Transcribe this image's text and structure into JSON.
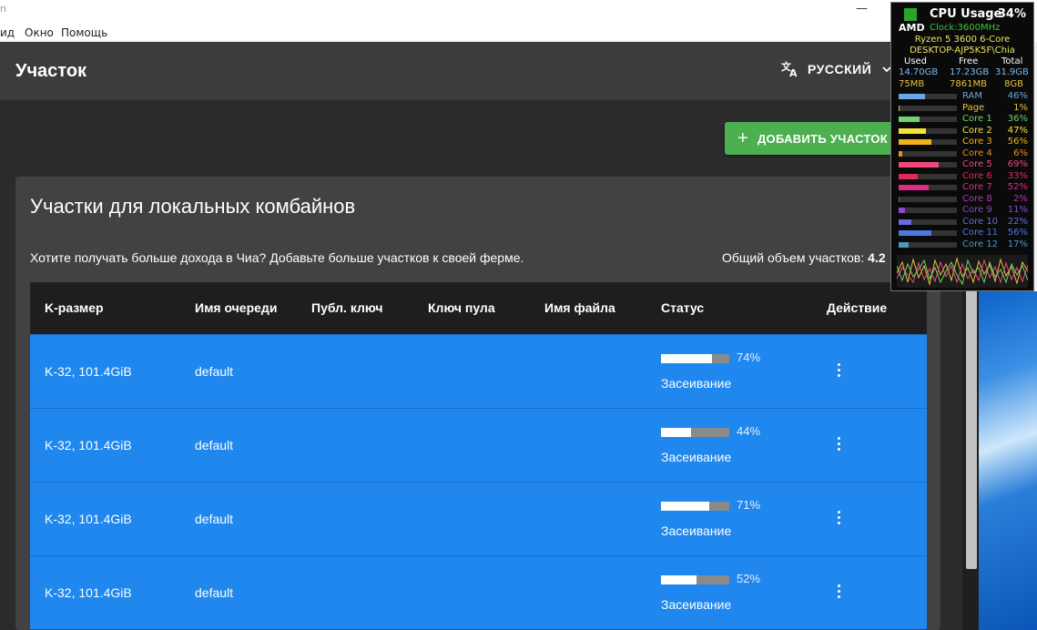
{
  "window": {
    "title_fragment": "n",
    "menu": [
      "ид",
      "Окно",
      "Помощь"
    ]
  },
  "appbar": {
    "title": "Участок",
    "language": "РУССКИЙ"
  },
  "add_button": {
    "label": "ДОБАВИТЬ УЧАСТОК"
  },
  "card": {
    "title": "Участки для локальных комбайнов",
    "description": "Хотите получать больше дохода в Чиа? Добавьте больше участков к своей ферме.",
    "total_label": "Общий объем участков:",
    "total_value": "4.2"
  },
  "table": {
    "headers": [
      "K-размер",
      "Имя очереди",
      "Публ. ключ",
      "Ключ пула",
      "Имя файла",
      "Статус",
      "Действие"
    ],
    "rows": [
      {
        "k_size": "K-32, 101.4GiB",
        "queue": "default",
        "progress": 74,
        "progress_label": "74%",
        "status": "Засеивание"
      },
      {
        "k_size": "K-32, 101.4GiB",
        "queue": "default",
        "progress": 44,
        "progress_label": "44%",
        "status": "Засеивание"
      },
      {
        "k_size": "K-32, 101.4GiB",
        "queue": "default",
        "progress": 71,
        "progress_label": "71%",
        "status": "Засеивание"
      },
      {
        "k_size": "K-32, 101.4GiB",
        "queue": "default",
        "progress": 52,
        "progress_label": "52%",
        "status": "Засеивание"
      }
    ]
  },
  "gadget": {
    "brand": "AMD",
    "title": "CPU Usage",
    "total": "34%",
    "clock": "Clock:3600MHz",
    "model": "Ryzen 5 3600 6-Core",
    "host": "DESKTOP-AJP5K5F\\Chia",
    "mem_headers": [
      "Used",
      "Free",
      "Total"
    ],
    "ram_stats": [
      "14.70GB",
      "17.23GB",
      "31.9GB"
    ],
    "page_stats": [
      "75MB",
      "7861MB",
      "8GB"
    ],
    "meters": [
      {
        "label": "RAM",
        "value": "46%",
        "level": 46,
        "color": "#6aa6e8"
      },
      {
        "label": "Page",
        "value": "1%",
        "level": 1,
        "color": "#e8c23a"
      },
      {
        "label": "Core 1",
        "value": "36%",
        "level": 36,
        "color": "#6fd36f"
      },
      {
        "label": "Core 2",
        "value": "47%",
        "level": 47,
        "color": "#f2e33a"
      },
      {
        "label": "Core 3",
        "value": "56%",
        "level": 56,
        "color": "#f2b21a"
      },
      {
        "label": "Core 4",
        "value": "6%",
        "level": 6,
        "color": "#f08a1a"
      },
      {
        "label": "Core 5",
        "value": "69%",
        "level": 69,
        "color": "#f04a7a"
      },
      {
        "label": "Core 6",
        "value": "33%",
        "level": 33,
        "color": "#e02a5a"
      },
      {
        "label": "Core 7",
        "value": "52%",
        "level": 52,
        "color": "#e02a8a"
      },
      {
        "label": "Core 8",
        "value": "2%",
        "level": 2,
        "color": "#b03ab0"
      },
      {
        "label": "Core 9",
        "value": "11%",
        "level": 11,
        "color": "#8a4ad0"
      },
      {
        "label": "Core 10",
        "value": "22%",
        "level": 22,
        "color": "#6a6ae0"
      },
      {
        "label": "Core 11",
        "value": "56%",
        "level": 56,
        "color": "#4a7ae0"
      },
      {
        "label": "Core 12",
        "value": "17%",
        "level": 17,
        "color": "#4a9ac0"
      }
    ]
  }
}
